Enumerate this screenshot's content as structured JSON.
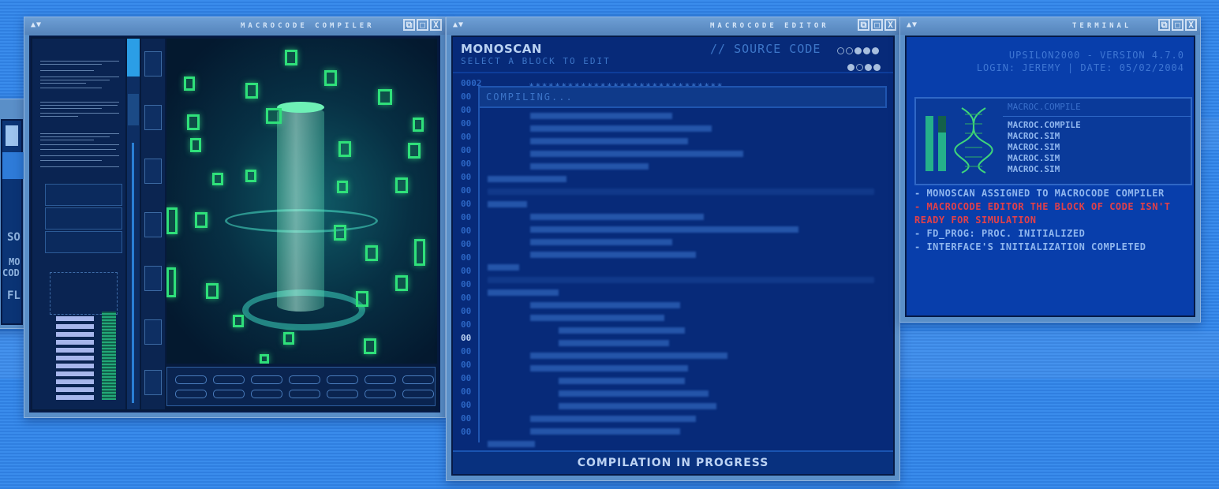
{
  "partial_window": {
    "labels": [
      "SO",
      "MO",
      "COD",
      "FL"
    ]
  },
  "compiler": {
    "title": "MACROCODE COMPILER",
    "arrows": "▲▼",
    "buttons": [
      "⧉",
      "□",
      "X"
    ]
  },
  "editor": {
    "title_bar": "MACROCODE EDITOR",
    "arrows": "▲▼",
    "buttons": [
      "⧉",
      "□",
      "X"
    ],
    "name": "MONOSCAN",
    "subtitle": "SELECT A BLOCK TO EDIT",
    "source_label": "// SOURCE CODE",
    "compiling_text": "COMPILING...",
    "stars": "******************************",
    "first_line_number": "0002",
    "gutter_glyph": "00",
    "status": "COMPILATION IN PROGRESS",
    "colors": {
      "accent": "#1d5fd0",
      "status_text": "#bcd3f3"
    }
  },
  "terminal": {
    "title": "TERMINAL",
    "arrows": "▲▼",
    "buttons": [
      "⧉",
      "□",
      "X"
    ],
    "version": "UPSILON2000 - VERSION 4.7.0",
    "login_line": "LOGIN: JEREMY | DATE: 05/02/2004",
    "list_header": "MACROC.COMPILE",
    "list_items": [
      "MACROC.COMPILE",
      "MACROC.SIM",
      "MACROC.SIM",
      "MACROC.SIM",
      "MACROC.SIM"
    ],
    "log": [
      {
        "text": "- MONOSCAN ASSIGNED TO MACROCODE COMPILER",
        "color": "#8fb6ee"
      },
      {
        "text": "- MACROCODE EDITOR THE BLOCK OF CODE ISN'T READY FOR SIMULATION",
        "color": "#e0404a"
      },
      {
        "text": "- FD_PROG: PROC. INITIALIZED",
        "color": "#8fb6ee"
      },
      {
        "text": "- INTERFACE'S INITIALIZATION COMPLETED",
        "color": "#8fb6ee"
      }
    ]
  }
}
